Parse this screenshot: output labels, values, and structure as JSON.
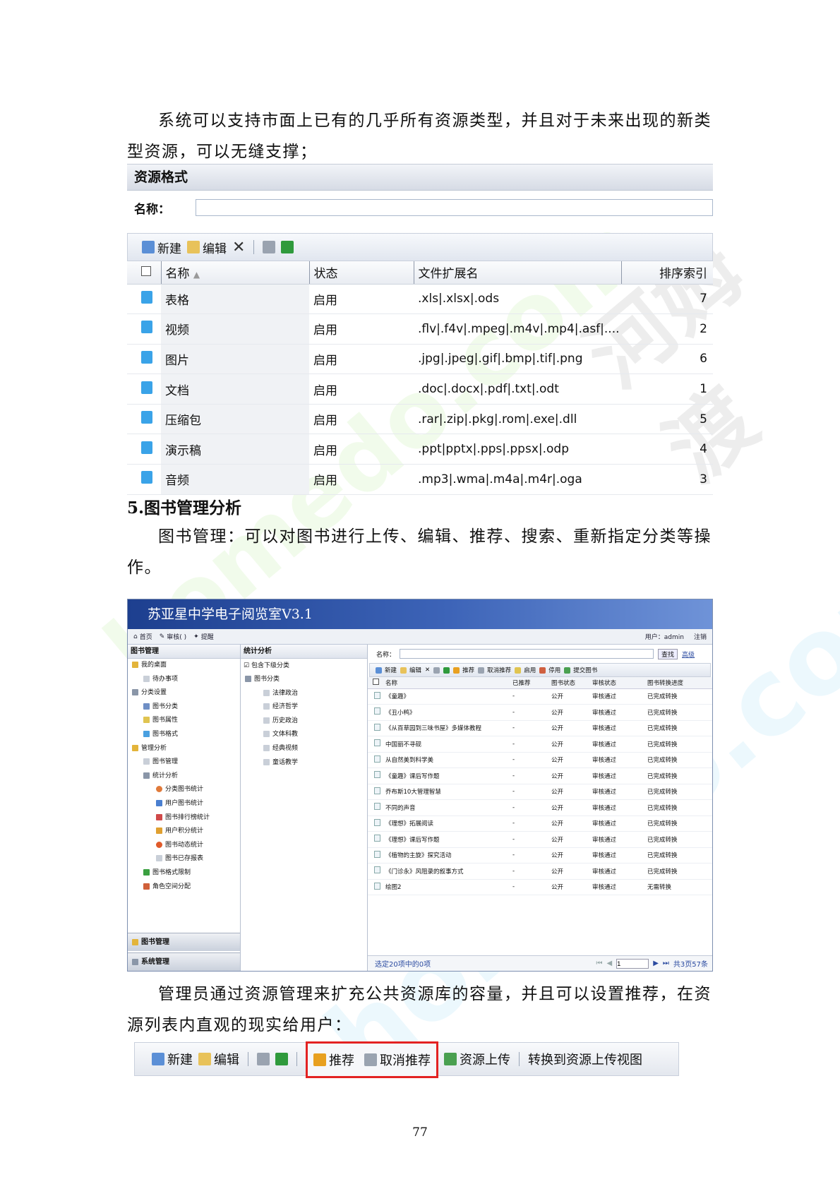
{
  "intro_lines": [
    "系统可以支持市面上已有的几乎所有资源类型，并且对于未来出现的新类",
    "型资源，可以无缝支撑；"
  ],
  "resource_format": {
    "title": "资源格式",
    "search_label": "名称：",
    "toolbar": {
      "new": "新建",
      "edit": "编辑"
    },
    "columns": [
      "名称",
      "状态",
      "文件扩展名",
      "排序索引"
    ],
    "rows": [
      {
        "name": "表格",
        "status": "启用",
        "ext": ".xls|.xlsx|.ods",
        "index": "7"
      },
      {
        "name": "视频",
        "status": "启用",
        "ext": ".flv|.f4v|.mpeg|.m4v|.mp4|.asf|....",
        "index": "2"
      },
      {
        "name": "图片",
        "status": "启用",
        "ext": ".jpg|.jpeg|.gif|.bmp|.tif|.png",
        "index": "6"
      },
      {
        "name": "文档",
        "status": "启用",
        "ext": ".doc|.docx|.pdf|.txt|.odt",
        "index": "1"
      },
      {
        "name": "压缩包",
        "status": "启用",
        "ext": ".rar|.zip|.pkg|.rom|.exe|.dll",
        "index": "5"
      },
      {
        "name": "演示稿",
        "status": "启用",
        "ext": ".ppt|pptx|.pps|.ppsx|.odp",
        "index": "4"
      },
      {
        "name": "音频",
        "status": "启用",
        "ext": ".mp3|.wma|.m4a|.m4r|.oga",
        "index": "3"
      }
    ]
  },
  "section_heading": "5.图书管理分析",
  "book_para_lines": [
    "图书管理：可以对图书进行上传、编辑、推荐、搜索、重新指定分类等操",
    "作。"
  ],
  "app": {
    "title": "苏亚星中学电子阅览室V3.1",
    "nav": {
      "home": "首页",
      "audit": "审核( )",
      "remind": "提醒",
      "user": "用户：admin",
      "logout": "注销"
    },
    "left_head": "图书管理",
    "left_tree": [
      "我的桌面",
      "待办事项",
      "分类设置",
      "图书分类",
      "图书属性",
      "图书格式",
      "管理分析",
      "图书管理",
      "统计分析",
      "分类图书统计",
      "用户图书统计",
      "图书排行榜统计",
      "用户积分统计",
      "图书动态统计",
      "图书已存报表",
      "图书格式限制",
      "角色空间分配"
    ],
    "left_nav": [
      "图书管理",
      "系统管理"
    ],
    "mid_head": "统计分析",
    "mid_check": "包含下级分类",
    "mid_tree": [
      "图书分类",
      "法律政治",
      "经济哲学",
      "历史政治",
      "文体科教",
      "经典视频",
      "童话教学"
    ],
    "search_label": "名称：",
    "search_btn": "查找",
    "search_adv": "高级",
    "toolbar": [
      "新建",
      "编辑",
      "推荐",
      "取消推荐",
      "启用",
      "停用",
      "提交图书"
    ],
    "columns": [
      "名称",
      "已推荐",
      "图书状态",
      "审核状态",
      "图书转换进度"
    ],
    "rows": [
      {
        "name": "《童趣》",
        "rec": "-",
        "state": "公开",
        "audit": "审核通过",
        "conv": "已完成转换"
      },
      {
        "name": "《丑小鸭》",
        "rec": "-",
        "state": "公开",
        "audit": "审核通过",
        "conv": "已完成转换"
      },
      {
        "name": "《从百草园到三味书屋》多媒体教程",
        "rec": "-",
        "state": "公开",
        "audit": "审核通过",
        "conv": "已完成转换"
      },
      {
        "name": "中国丽不寻砚",
        "rec": "-",
        "state": "公开",
        "audit": "审核通过",
        "conv": "已完成转换"
      },
      {
        "name": "从自然美到科学美",
        "rec": "-",
        "state": "公开",
        "audit": "审核通过",
        "conv": "已完成转换"
      },
      {
        "name": "《童趣》课后写作题",
        "rec": "-",
        "state": "公开",
        "audit": "审核通过",
        "conv": "已完成转换"
      },
      {
        "name": "乔布斯10大管理智慧",
        "rec": "-",
        "state": "公开",
        "audit": "审核通过",
        "conv": "已完成转换"
      },
      {
        "name": "不同的声音",
        "rec": "-",
        "state": "公开",
        "audit": "审核通过",
        "conv": "已完成转换"
      },
      {
        "name": "《理想》拓展阅读",
        "rec": "-",
        "state": "公开",
        "audit": "审核通过",
        "conv": "已完成转换"
      },
      {
        "name": "《理想》课后写作题",
        "rec": "-",
        "state": "公开",
        "audit": "审核通过",
        "conv": "已完成转换"
      },
      {
        "name": "《植物的主旋》探究活动",
        "rec": "-",
        "state": "公开",
        "audit": "审核通过",
        "conv": "已完成转换"
      },
      {
        "name": "《门诊永》风阻录的叙事方式",
        "rec": "-",
        "state": "公开",
        "audit": "审核通过",
        "conv": "已完成转换"
      },
      {
        "name": "绘图2",
        "rec": "-",
        "state": "公开",
        "audit": "审核通过",
        "conv": "无需转换"
      }
    ],
    "footer_left": "选定20项中的0项",
    "page_value": "1",
    "footer_right": "共3页57条"
  },
  "admin_para_lines": [
    "管理员通过资源管理来扩充公共资源库的容量，并且可以设置推荐，在资",
    "源列表内直观的现实给用户："
  ],
  "bottom_toolbar": {
    "new": "新建",
    "edit": "编辑",
    "recommend": "推荐",
    "cancel_recommend": "取消推荐",
    "upload": "资源上传",
    "switch_view": "转换到资源上传视图",
    "highlight_color": "#e32222"
  },
  "page_number": "77"
}
